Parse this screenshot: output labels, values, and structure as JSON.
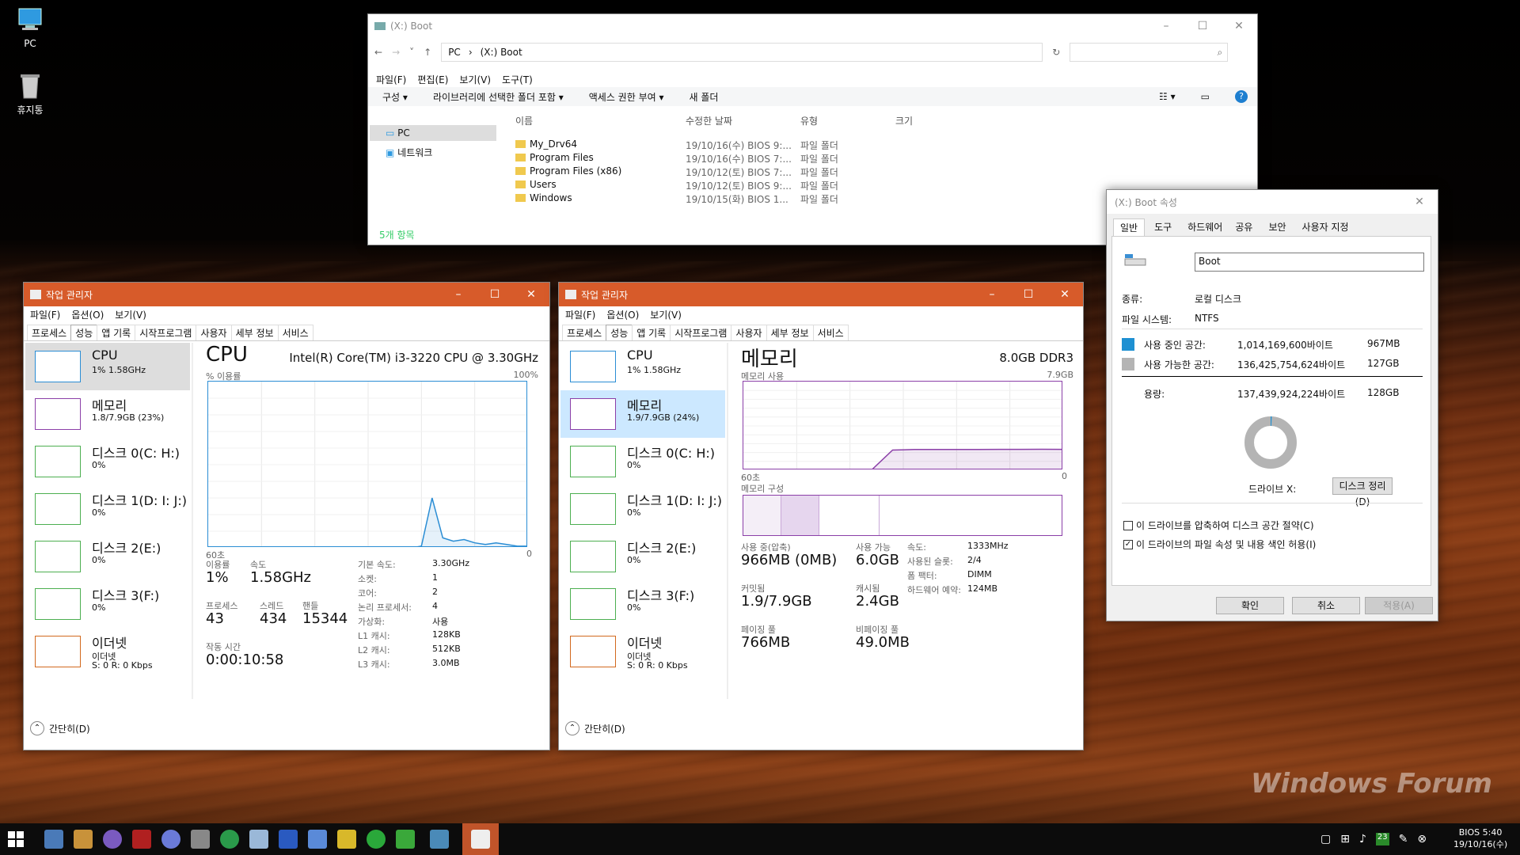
{
  "desktop": {
    "icons": [
      {
        "label": "PC"
      },
      {
        "label": "휴지통"
      }
    ],
    "watermark": "Windows Forum"
  },
  "explorer": {
    "title": "(X:) Boot",
    "path": [
      "PC",
      "(X:) Boot"
    ],
    "menu": [
      "파일(F)",
      "편집(E)",
      "보기(V)",
      "도구(T)"
    ],
    "toolbar": [
      "구성",
      "라이브러리에 선택한 폴더 포함",
      "액세스 권한 부여",
      "새 폴더"
    ],
    "nav": [
      "PC",
      "네트워크"
    ],
    "columns": [
      "이름",
      "수정한 날짜",
      "유형",
      "크기"
    ],
    "rows": [
      {
        "name": "My_Drv64",
        "date": "19/10/16(수) BIOS  9:...",
        "type": "파일 폴더"
      },
      {
        "name": "Program Files",
        "date": "19/10/16(수) BIOS  7:...",
        "type": "파일 폴더"
      },
      {
        "name": "Program Files (x86)",
        "date": "19/10/12(토) BIOS  7:...",
        "type": "파일 폴더"
      },
      {
        "name": "Users",
        "date": "19/10/12(토) BIOS  9:...",
        "type": "파일 폴더"
      },
      {
        "name": "Windows",
        "date": "19/10/15(화) BIOS  1...",
        "type": "파일 폴더"
      }
    ],
    "status": "5개 항목"
  },
  "props": {
    "title": "(X:) Boot 속성",
    "tabs": [
      "일반",
      "도구",
      "하드웨어",
      "공유",
      "보안",
      "사용자 지정"
    ],
    "name_value": "Boot",
    "type_label": "종류:",
    "type_value": "로컬 디스크",
    "fs_label": "파일 시스템:",
    "fs_value": "NTFS",
    "used_label": "사용 중인 공간:",
    "used_bytes": "1,014,169,600바이트",
    "used_size": "967MB",
    "free_label": "사용 가능한 공간:",
    "free_bytes": "136,425,754,624바이트",
    "free_size": "127GB",
    "cap_label": "용량:",
    "cap_bytes": "137,439,924,224바이트",
    "cap_size": "128GB",
    "used_fraction": 0.007,
    "drive_label": "드라이브 X:",
    "cleanup": "디스크 정리(D)",
    "compress": "이 드라이브를 압축하여 디스크 공간 절약(C)",
    "index": "이 드라이브의 파일 속성 및 내용 색인 허용(I)",
    "index_checked": true,
    "buttons": [
      "확인",
      "취소",
      "적용(A)"
    ],
    "colors": {
      "used": "#1e90d2",
      "free": "#b4b4b4"
    }
  },
  "tm_common": {
    "title": "작업 관리자",
    "menu": [
      "파일(F)",
      "옵션(O)",
      "보기(V)"
    ],
    "tabs": [
      "프로세스",
      "성능",
      "앱 기록",
      "시작프로그램",
      "사용자",
      "세부 정보",
      "서비스"
    ],
    "side": [
      {
        "name": "CPU",
        "v1": "1% 1.58GHz",
        "v2": ""
      },
      {
        "name": "메모리",
        "v1": "1.8/7.9GB (23%)",
        "v2": ""
      },
      {
        "name": "디스크 0(C: H:)",
        "v1": "0%",
        "v2": ""
      },
      {
        "name": "디스크 1(D: I: J:)",
        "v1": "0%",
        "v2": ""
      },
      {
        "name": "디스크 2(E:)",
        "v1": "0%",
        "v2": ""
      },
      {
        "name": "디스크 3(F:)",
        "v1": "0%",
        "v2": ""
      },
      {
        "name": "이더넷",
        "v1": "이더넷",
        "v2": "S: 0 R: 0 Kbps"
      }
    ],
    "fewer": "간단히(D)"
  },
  "tm1": {
    "heading": "CPU",
    "model": "Intel(R) Core(TM) i3-3220 CPU @ 3.30GHz",
    "g_label": "% 이용률",
    "g_max": "100%",
    "g_left": "60초",
    "g_right": "0",
    "util_label": "이용률",
    "util": "1%",
    "speed_label": "속도",
    "speed": "1.58GHz",
    "proc_label": "프로세스",
    "proc": "43",
    "thr_label": "스레드",
    "thr": "434",
    "hnd_label": "핸들",
    "hnd": "15344",
    "uptime_label": "작동 시간",
    "uptime": "0:00:10:58",
    "specs": [
      [
        "기본 속도:",
        "3.30GHz"
      ],
      [
        "소켓:",
        "1"
      ],
      [
        "코어:",
        "2"
      ],
      [
        "논리 프로세서:",
        "4"
      ],
      [
        "가상화:",
        "사용"
      ],
      [
        "L1 캐시:",
        "128KB"
      ],
      [
        "L2 캐시:",
        "512KB"
      ],
      [
        "L3 캐시:",
        "3.0MB"
      ]
    ],
    "chart_data": {
      "type": "line",
      "x": [
        60,
        58,
        56,
        54,
        52,
        50,
        48,
        46,
        44,
        42,
        40,
        38,
        36,
        34,
        32,
        30,
        28,
        26,
        24,
        22,
        20,
        18,
        16,
        14,
        12,
        10,
        8,
        6,
        4,
        2,
        0
      ],
      "series": [
        {
          "values": [
            0,
            0,
            0,
            0,
            0,
            0,
            0,
            0,
            0,
            0,
            0,
            0,
            0,
            0,
            0,
            0,
            0,
            0,
            0,
            0,
            1,
            30,
            6,
            4,
            5,
            3,
            2,
            3,
            2,
            1,
            1
          ]
        }
      ],
      "ylim": [
        0,
        100
      ],
      "color": "#2a8dd4"
    }
  },
  "tm2": {
    "heading": "메모리",
    "model": "8.0GB DDR3",
    "side_mem": "1.9/7.9GB (24%)",
    "g_label": "메모리 사용",
    "g_max": "7.9GB",
    "g_left": "60초",
    "g_right": "0",
    "comp_label": "메모리 구성",
    "inuse_label": "사용 중(압축)",
    "inuse": "966MB (0MB)",
    "avail_label": "사용 가능",
    "avail": "6.0GB",
    "commit_label": "커밋됨",
    "commit": "1.9/7.9GB",
    "cached_label": "캐시됨",
    "cached": "2.4GB",
    "paged_label": "페이징 풀",
    "paged": "766MB",
    "nonpaged_label": "비페이징 풀",
    "nonpaged": "49.0MB",
    "specs": [
      [
        "속도:",
        "1333MHz"
      ],
      [
        "사용된 슬롯:",
        "2/4"
      ],
      [
        "폼 팩터:",
        "DIMM"
      ],
      [
        "하드웨어 예약:",
        "124MB"
      ]
    ],
    "chart_data": {
      "type": "area",
      "x": [
        60,
        56,
        52,
        48,
        44,
        40,
        36,
        32,
        28,
        24,
        20,
        16,
        12,
        8,
        4,
        0
      ],
      "series": [
        {
          "values": [
            0,
            0,
            0,
            0,
            0,
            0,
            0,
            1.8,
            1.85,
            1.85,
            1.85,
            1.85,
            1.86,
            1.86,
            1.87,
            1.86
          ]
        }
      ],
      "ylim": [
        0,
        7.9
      ],
      "color": "#8b3fa8"
    }
  },
  "tray": {
    "time": "BIOS  5:40",
    "date": "19/10/16(수)",
    "badge": "23"
  }
}
